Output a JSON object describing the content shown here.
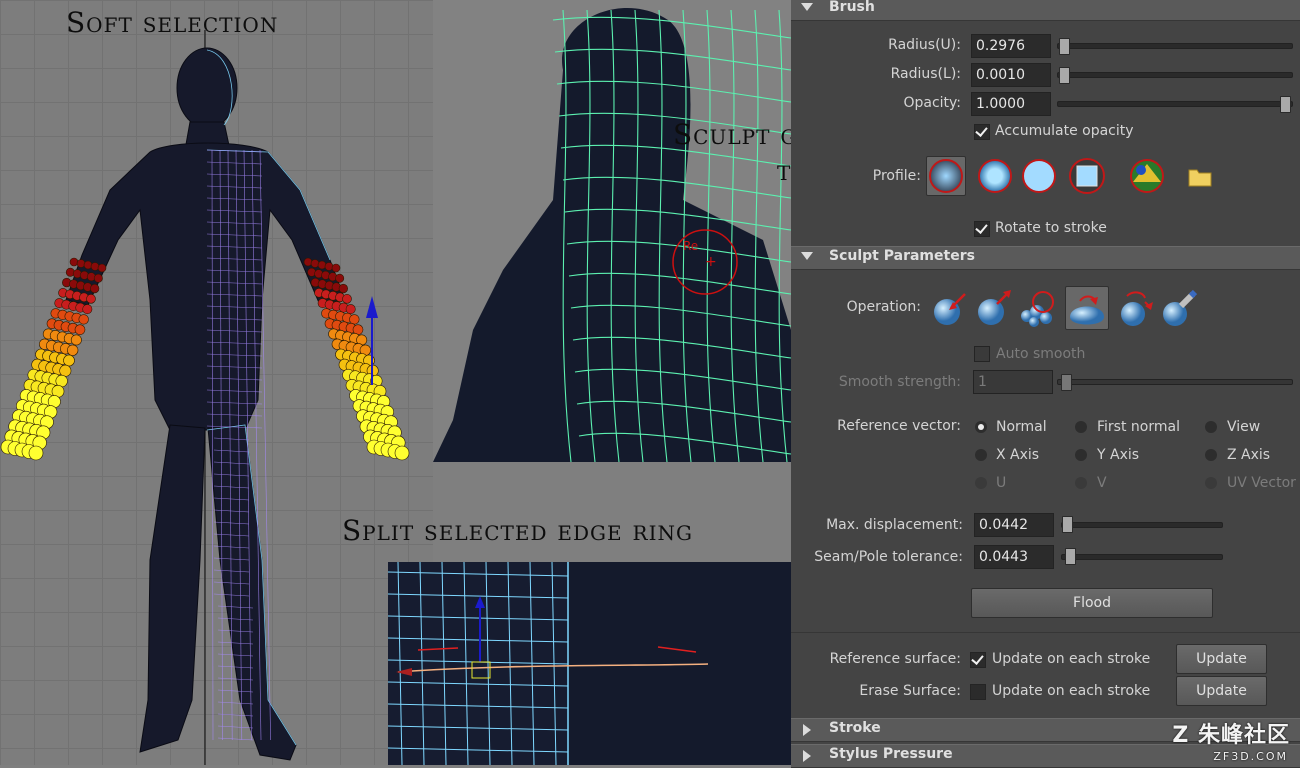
{
  "captions": {
    "soft_selection": "Soft selection",
    "sculpt_line1": "Sculpt geometry",
    "sculpt_line2": "tool",
    "split_edge_ring": "Split selected edge ring"
  },
  "brush": {
    "header": "Brush",
    "radius_u_label": "Radius(U):",
    "radius_u_value": "0.2976",
    "radius_u_level": 0.01,
    "radius_l_label": "Radius(L):",
    "radius_l_value": "0.0010",
    "radius_l_level": 0.0,
    "opacity_label": "Opacity:",
    "opacity_value": "1.0000",
    "opacity_level": 1.0,
    "accumulate_opacity_label": "Accumulate opacity",
    "accumulate_opacity_checked": true,
    "profile_label": "Profile:",
    "profile_icons": [
      "soft-brush-icon",
      "medium-brush-icon",
      "solid-circle-brush-icon",
      "square-brush-icon",
      "image-brush-icon",
      "folder-icon"
    ],
    "rotate_to_stroke_label": "Rotate to stroke",
    "rotate_to_stroke_checked": true
  },
  "sculpt": {
    "header": "Sculpt Parameters",
    "operation_label": "Operation:",
    "operation_icons": [
      "push-icon",
      "pull-icon",
      "smooth-icon",
      "relax-icon",
      "pinch-icon",
      "erase-icon"
    ],
    "auto_smooth_label": "Auto smooth",
    "smooth_strength_label": "Smooth strength:",
    "smooth_strength_value": "1",
    "reference_vector_label": "Reference vector:",
    "reference_vector_options": [
      "Normal",
      "First normal",
      "View",
      "X Axis",
      "Y Axis",
      "Z Axis",
      "U",
      "V",
      "UV Vector"
    ],
    "reference_vector_selected": "Normal",
    "max_displacement_label": "Max. displacement:",
    "max_displacement_value": "0.0442",
    "seam_pole_label": "Seam/Pole tolerance:",
    "seam_pole_value": "0.0443",
    "flood_label": "Flood",
    "reference_surface_label": "Reference surface:",
    "reference_surface_update_label": "Update on each stroke",
    "reference_surface_checked": true,
    "erase_surface_label": "Erase Surface:",
    "erase_surface_update_label": "Update on each stroke",
    "erase_surface_checked": false,
    "update_label": "Update"
  },
  "collapsed_sections": [
    "Stroke",
    "Stylus Pressure"
  ],
  "watermark": {
    "main": "Z 朱峰社区",
    "sub": "ZF3D.COM"
  }
}
